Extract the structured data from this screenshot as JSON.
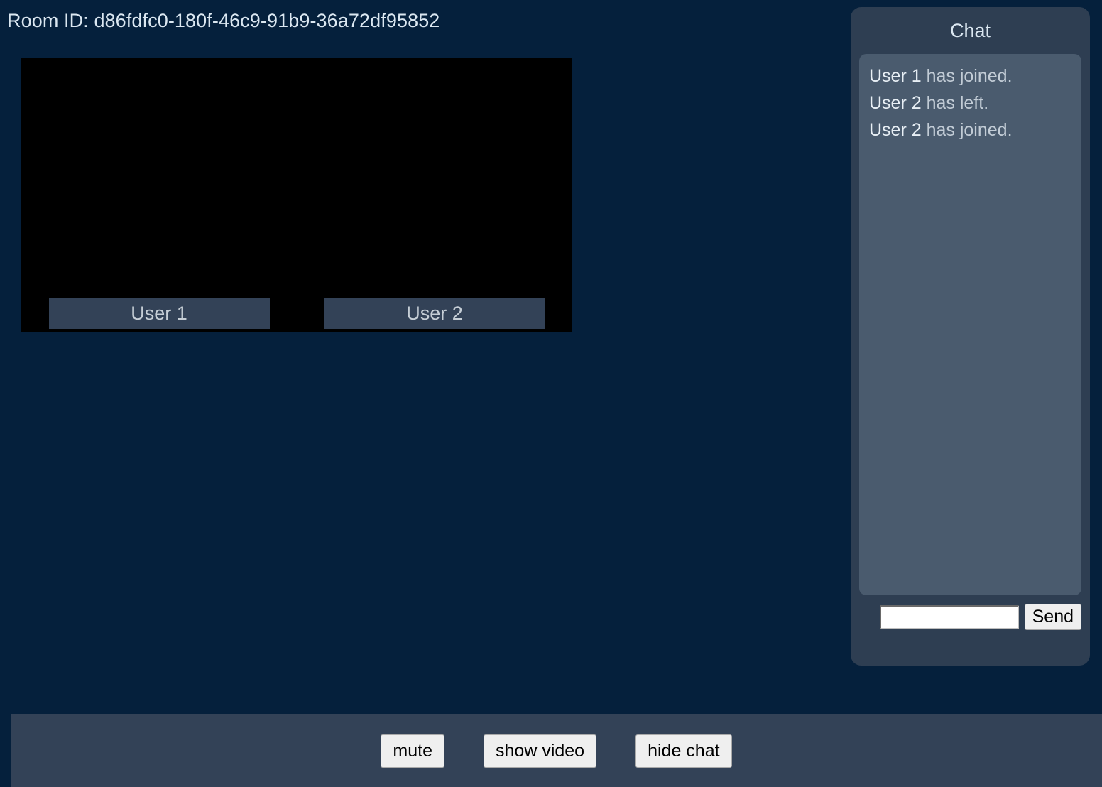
{
  "room": {
    "id_label": "Room ID:",
    "id_value": "d86fdfc0-180f-46c9-91b9-36a72df95852",
    "id_full_line": "Room ID: d86fdfc0-180f-46c9-91b9-36a72df95852"
  },
  "video": {
    "tiles": [
      {
        "name": "User 1"
      },
      {
        "name": "User 2"
      }
    ]
  },
  "chat": {
    "title": "Chat",
    "messages": [
      {
        "author": "User 1",
        "text": " has joined.",
        "full": "User 1 has joined."
      },
      {
        "author": "User 2",
        "text": " has left.",
        "full": "User 2 has left."
      },
      {
        "author": "User 2",
        "text": " has joined.",
        "full": "User 2 has joined."
      }
    ],
    "input_value": "",
    "input_placeholder": "",
    "send_label": "Send"
  },
  "controls": {
    "buttons": [
      {
        "label": "mute",
        "name": "mute-button"
      },
      {
        "label": "show video",
        "name": "show-video-button"
      },
      {
        "label": "hide chat",
        "name": "hide-chat-button"
      }
    ]
  },
  "colors": {
    "background": "#05203c",
    "panel": "#2e3e52",
    "panel_inner": "#4a5b6e",
    "control_bar": "#334257",
    "nameplate": "#334257",
    "text_primary": "#dbe7f1",
    "text_secondary": "#c2ccd6",
    "video_surface": "#000000",
    "button_face": "#efefef"
  }
}
